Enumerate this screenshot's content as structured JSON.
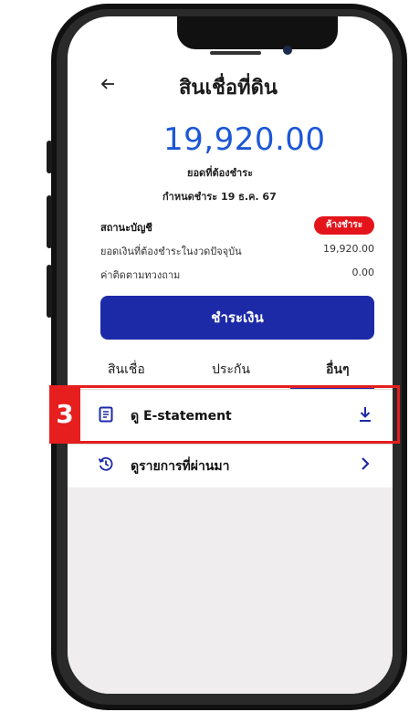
{
  "screen": {
    "title": "สินเชื่อที่ดิน",
    "amount": "19,920.00",
    "amount_label": "ยอดที่ต้องชำระ",
    "due_date": "กำหนดชำระ 19 ธ.ค. 67"
  },
  "account": {
    "status_label": "สถานะบัญชี",
    "status_badge": "ค้างชำระ",
    "rows": [
      {
        "label": "ยอดเงินที่ต้องชำระในงวดปัจจุบัน",
        "value": "19,920.00"
      },
      {
        "label": "ค่าติดตามทวงถาม",
        "value": "0.00"
      }
    ]
  },
  "actions": {
    "pay_label": "ชำระเงิน"
  },
  "tabs": [
    {
      "label": "สินเชื่อ",
      "active": false
    },
    {
      "label": "ประกัน",
      "active": false
    },
    {
      "label": "อื่นๆ",
      "active": true
    }
  ],
  "list": [
    {
      "label": "ดู E-statement",
      "icon": "document-icon",
      "action_icon": "download-icon"
    },
    {
      "label": "ดูรายการที่ผ่านมา",
      "icon": "history-icon",
      "action_icon": "chevron-right-icon"
    }
  ],
  "annotation": {
    "step": "3"
  },
  "colors": {
    "primary_blue": "#1c2aa8",
    "amount_blue": "#1c57d6",
    "badge_red": "#e4141b",
    "highlight_red": "#e61e1e"
  }
}
